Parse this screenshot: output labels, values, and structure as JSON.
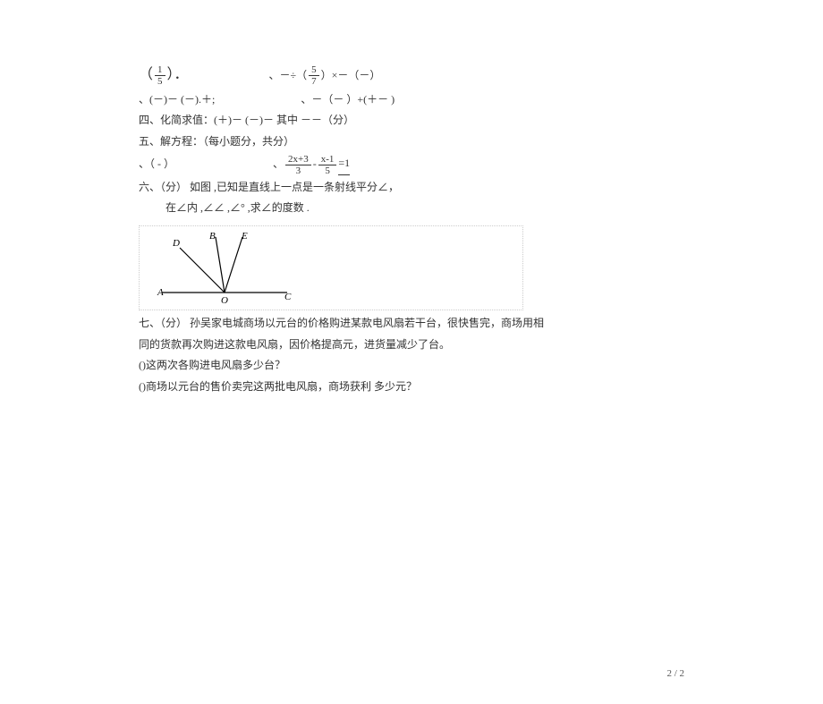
{
  "line1": {
    "lparen": "（",
    "frac_num": "1",
    "frac_den": "5",
    "rparen": "）．",
    "sep": "、",
    "expr_prefix": "－÷（",
    "frac2_num": "5",
    "frac2_den": "7",
    "expr_suffix": "）×－（－）"
  },
  "line2": {
    "left": "、(－)－ (－).＋;",
    "right": "、－（－ ）+(＋－ )"
  },
  "line3": "四、化简求值：(＋)－ (－)－  其中   －－（分）",
  "line4": "五、解方程：（每小题分，共分）",
  "line5": {
    "left": "、（ - ）",
    "sep": "、",
    "f1_num": "2x+3",
    "f1_den": "3",
    "minus": "-",
    "f2_num": "x-1",
    "f2_den": "5",
    "eq": "=1"
  },
  "line6": "六、（分）  如图 ,已知是直线上一点是一条射线平分∠，",
  "line7": "在∠内 ,∠∠ ,∠°  ,求∠的度数 .",
  "figure": {
    "labels": {
      "A": "A",
      "B": "B",
      "C": "C",
      "D": "D",
      "E": "E",
      "O": "O"
    }
  },
  "line8": "七、（分）  孙吴家电城商场以元台的价格购进某款电风扇若干台，很快售完，商场用相",
  "line9": "同的货款再次购进这款电风扇，因价格提高元，进货量减少了台。",
  "line10": "()这两次各购进电风扇多少台？",
  "line11": "()商场以元台的售价卖完这两批电风扇，商场获利   多少元？",
  "pagenum": "2 / 2"
}
